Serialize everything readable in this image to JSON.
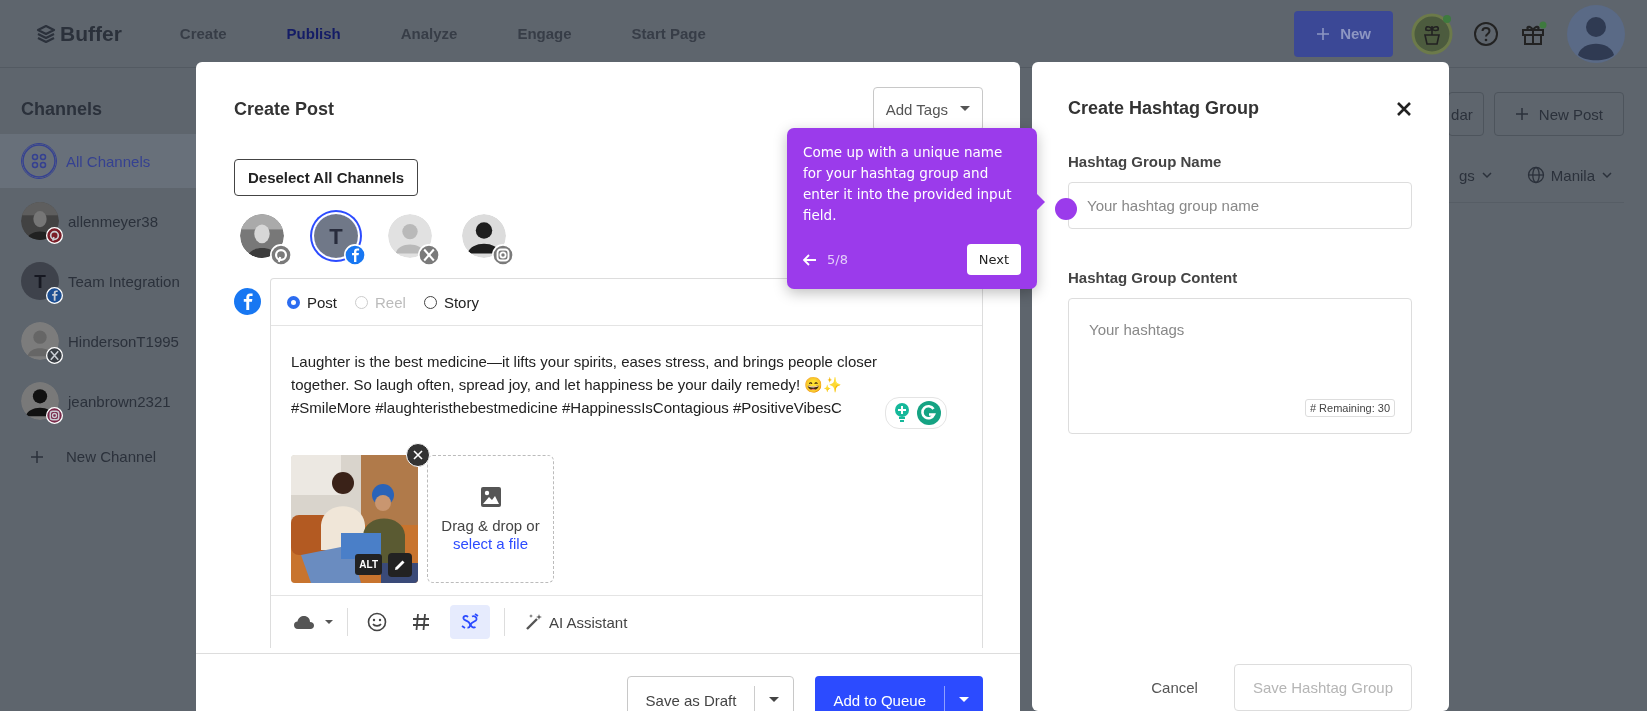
{
  "topbar": {
    "logo": "Buffer",
    "nav": [
      {
        "label": "Create",
        "selected": false
      },
      {
        "label": "Publish",
        "selected": true
      },
      {
        "label": "Analyze",
        "selected": false
      },
      {
        "label": "Engage",
        "selected": false
      },
      {
        "label": "Start Page",
        "selected": false
      }
    ],
    "new_button": "New"
  },
  "sidebar": {
    "title": "Channels",
    "channels": [
      {
        "name": "All Channels",
        "kind": "all",
        "selected": true
      },
      {
        "name": "allenmeyer38",
        "kind": "pinterest",
        "selected": false
      },
      {
        "name": "Team Integration",
        "kind": "facebook",
        "initial": "T",
        "selected": false
      },
      {
        "name": "HindersonT1995",
        "kind": "x",
        "selected": false
      },
      {
        "name": "jeanbrown2321",
        "kind": "instagram",
        "selected": false
      }
    ],
    "new_channel": "New Channel"
  },
  "background_toolbar": {
    "calendar_button": "dar",
    "new_post_button": "New Post",
    "tags_filter": "gs",
    "timezone": "Manila"
  },
  "create_post": {
    "title": "Create Post",
    "add_tags": "Add Tags",
    "deselect_button": "Deselect All Channels",
    "channels": [
      {
        "kind": "pinterest",
        "selected": false
      },
      {
        "kind": "facebook",
        "initial": "T",
        "selected": true
      },
      {
        "kind": "x",
        "selected": false
      },
      {
        "kind": "instagram",
        "selected": false
      }
    ],
    "post_types": [
      {
        "label": "Post",
        "selected": true,
        "disabled": false
      },
      {
        "label": "Reel",
        "selected": false,
        "disabled": true
      },
      {
        "label": "Story",
        "selected": false,
        "disabled": false
      }
    ],
    "text": "Laughter is the best medicine—it lifts your spirits, eases stress, and brings people closer together. So laugh often, spread joy, and let happiness be your daily remedy! 😄✨\n#SmileMore #laughteristhebestmedicine #HappinessIsContagious #PositiveVibesC",
    "media": {
      "kind": "picture",
      "alt_badge": "ALT"
    },
    "dropzone": {
      "text": "Drag & drop or",
      "link": "select a file"
    },
    "toolbar": {
      "link_shortener_on": true,
      "ai_assistant": "AI Assistant"
    },
    "footer": {
      "save_draft": "Save as Draft",
      "add_to_queue": "Add to Queue"
    }
  },
  "tooltip": {
    "text": "Come up with a unique name for your hashtag group and enter it into the provided input field.",
    "step": "5/8",
    "next": "Next"
  },
  "hashtag_group": {
    "title": "Create Hashtag Group",
    "name_label": "Hashtag Group Name",
    "name_placeholder": "Your hashtag group name",
    "content_label": "Hashtag Group Content",
    "content_placeholder": "Your hashtags",
    "remaining": "# Remaining: 30",
    "cancel": "Cancel",
    "save": "Save Hashtag Group",
    "save_disabled": true
  }
}
